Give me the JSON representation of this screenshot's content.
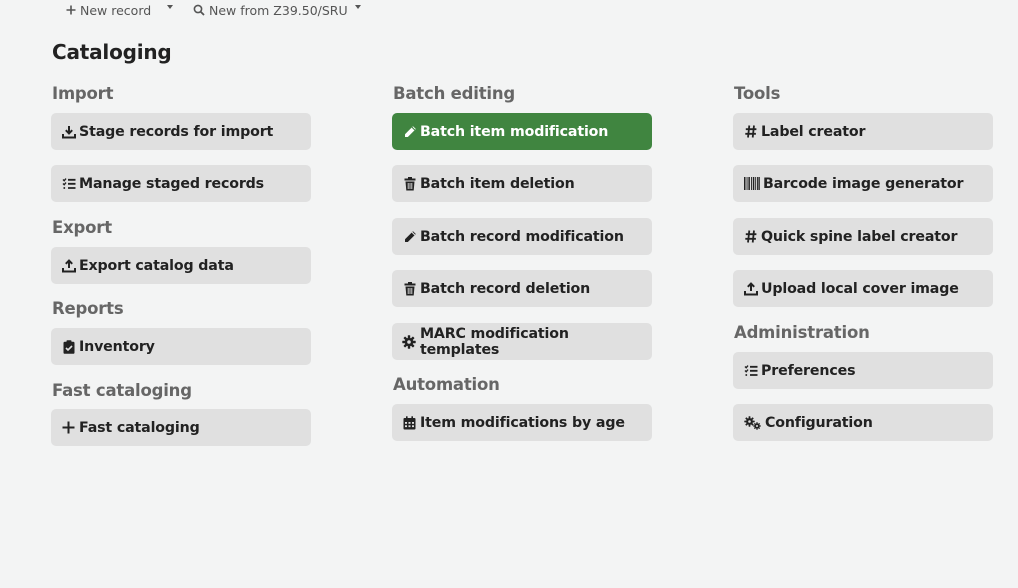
{
  "toolbar": {
    "new_record_label": "New record",
    "new_z3950_label": "New from Z39.50/SRU"
  },
  "page_title": "Cataloging",
  "columns": {
    "import": {
      "heading": "Import",
      "items": [
        "Stage records for import",
        "Manage staged records"
      ]
    },
    "export": {
      "heading": "Export",
      "items": [
        "Export catalog data"
      ]
    },
    "reports": {
      "heading": "Reports",
      "items": [
        "Inventory"
      ]
    },
    "fast_cataloging": {
      "heading": "Fast cataloging",
      "items": [
        "Fast cataloging"
      ]
    },
    "batch_editing": {
      "heading": "Batch editing",
      "items": [
        "Batch item modification",
        "Batch item deletion",
        "Batch record modification",
        "Batch record deletion",
        "MARC modification templates"
      ]
    },
    "automation": {
      "heading": "Automation",
      "items": [
        "Item modifications by age"
      ]
    },
    "tools": {
      "heading": "Tools",
      "items": [
        "Label creator",
        "Barcode image generator",
        "Quick spine label creator",
        "Upload local cover image"
      ]
    },
    "administration": {
      "heading": "Administration",
      "items": [
        "Preferences",
        "Configuration"
      ]
    }
  },
  "colors": {
    "active_button": "#408540",
    "button": "#e0e0e0",
    "background": "#f3f4f4"
  },
  "icons": {
    "stage_records": "download-icon",
    "manage_staged": "list-check-icon",
    "export_catalog": "upload-icon",
    "inventory": "clipboard-check-icon",
    "fast_cataloging": "plus-icon",
    "batch_item_mod": "pencil-icon",
    "batch_item_del": "trash-icon",
    "batch_record_mod": "pencil-icon",
    "batch_record_del": "trash-icon",
    "marc_templates": "gear-icon",
    "item_mod_age": "calendar-icon",
    "label_creator": "hashtag-icon",
    "barcode": "barcode-icon",
    "spine_label": "hashtag-icon",
    "upload_cover": "upload-icon",
    "preferences": "list-check-icon",
    "configuration": "gears-icon"
  }
}
